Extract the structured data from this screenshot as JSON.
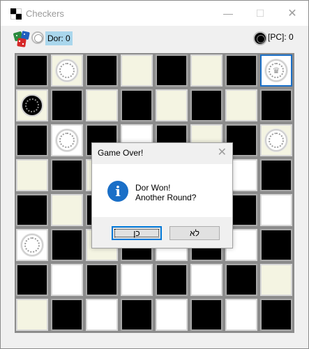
{
  "window": {
    "title": "Checkers",
    "minimize_icon": "—",
    "maximize_icon": "☐",
    "close_icon": "✕"
  },
  "toolbar": {
    "player_label": "Dor: 0",
    "pc_label": "[PC]: 0"
  },
  "board": {
    "rows": [
      [
        {
          "c": "dark",
          "p": ""
        },
        {
          "c": "light",
          "p": "w"
        },
        {
          "c": "dark",
          "p": ""
        },
        {
          "c": "light",
          "p": ""
        },
        {
          "c": "dark",
          "p": ""
        },
        {
          "c": "light",
          "p": ""
        },
        {
          "c": "dark",
          "p": ""
        },
        {
          "c": "selected",
          "p": "wk"
        }
      ],
      [
        {
          "c": "light",
          "p": "b"
        },
        {
          "c": "dark",
          "p": ""
        },
        {
          "c": "light",
          "p": ""
        },
        {
          "c": "dark",
          "p": ""
        },
        {
          "c": "light",
          "p": ""
        },
        {
          "c": "dark",
          "p": ""
        },
        {
          "c": "light",
          "p": ""
        },
        {
          "c": "dark",
          "p": ""
        }
      ],
      [
        {
          "c": "dark",
          "p": ""
        },
        {
          "c": "white",
          "p": "w"
        },
        {
          "c": "dark",
          "p": ""
        },
        {
          "c": "white",
          "p": ""
        },
        {
          "c": "dark",
          "p": ""
        },
        {
          "c": "light",
          "p": ""
        },
        {
          "c": "dark",
          "p": ""
        },
        {
          "c": "light",
          "p": "w"
        }
      ],
      [
        {
          "c": "light",
          "p": ""
        },
        {
          "c": "dark",
          "p": ""
        },
        {
          "c": "light",
          "p": ""
        },
        {
          "c": "dark",
          "p": ""
        },
        {
          "c": "light",
          "p": ""
        },
        {
          "c": "dark",
          "p": ""
        },
        {
          "c": "white",
          "p": ""
        },
        {
          "c": "dark",
          "p": ""
        }
      ],
      [
        {
          "c": "dark",
          "p": ""
        },
        {
          "c": "light",
          "p": ""
        },
        {
          "c": "dark",
          "p": ""
        },
        {
          "c": "light",
          "p": ""
        },
        {
          "c": "dark",
          "p": ""
        },
        {
          "c": "light",
          "p": ""
        },
        {
          "c": "dark",
          "p": ""
        },
        {
          "c": "white",
          "p": ""
        }
      ],
      [
        {
          "c": "white",
          "p": "w"
        },
        {
          "c": "dark",
          "p": ""
        },
        {
          "c": "light",
          "p": ""
        },
        {
          "c": "dark",
          "p": ""
        },
        {
          "c": "white",
          "p": ""
        },
        {
          "c": "dark",
          "p": ""
        },
        {
          "c": "white",
          "p": ""
        },
        {
          "c": "dark",
          "p": ""
        }
      ],
      [
        {
          "c": "dark",
          "p": ""
        },
        {
          "c": "white",
          "p": ""
        },
        {
          "c": "dark",
          "p": ""
        },
        {
          "c": "white",
          "p": ""
        },
        {
          "c": "dark",
          "p": ""
        },
        {
          "c": "white",
          "p": ""
        },
        {
          "c": "dark",
          "p": ""
        },
        {
          "c": "light",
          "p": ""
        }
      ],
      [
        {
          "c": "light",
          "p": ""
        },
        {
          "c": "dark",
          "p": ""
        },
        {
          "c": "white",
          "p": ""
        },
        {
          "c": "dark",
          "p": ""
        },
        {
          "c": "white",
          "p": ""
        },
        {
          "c": "dark",
          "p": ""
        },
        {
          "c": "white",
          "p": ""
        },
        {
          "c": "dark",
          "p": ""
        }
      ]
    ]
  },
  "dialog": {
    "title": "Game Over!",
    "close_icon": "✕",
    "info_icon": "i",
    "message_line1": "Dor Won!",
    "message_line2": "Another Round?",
    "yes_label": "כן",
    "no_label": "לא"
  },
  "colors": {
    "accent": "#1a6fc7",
    "player_highlight": "#a9d6ec",
    "light_square": "#f4f4e2"
  }
}
